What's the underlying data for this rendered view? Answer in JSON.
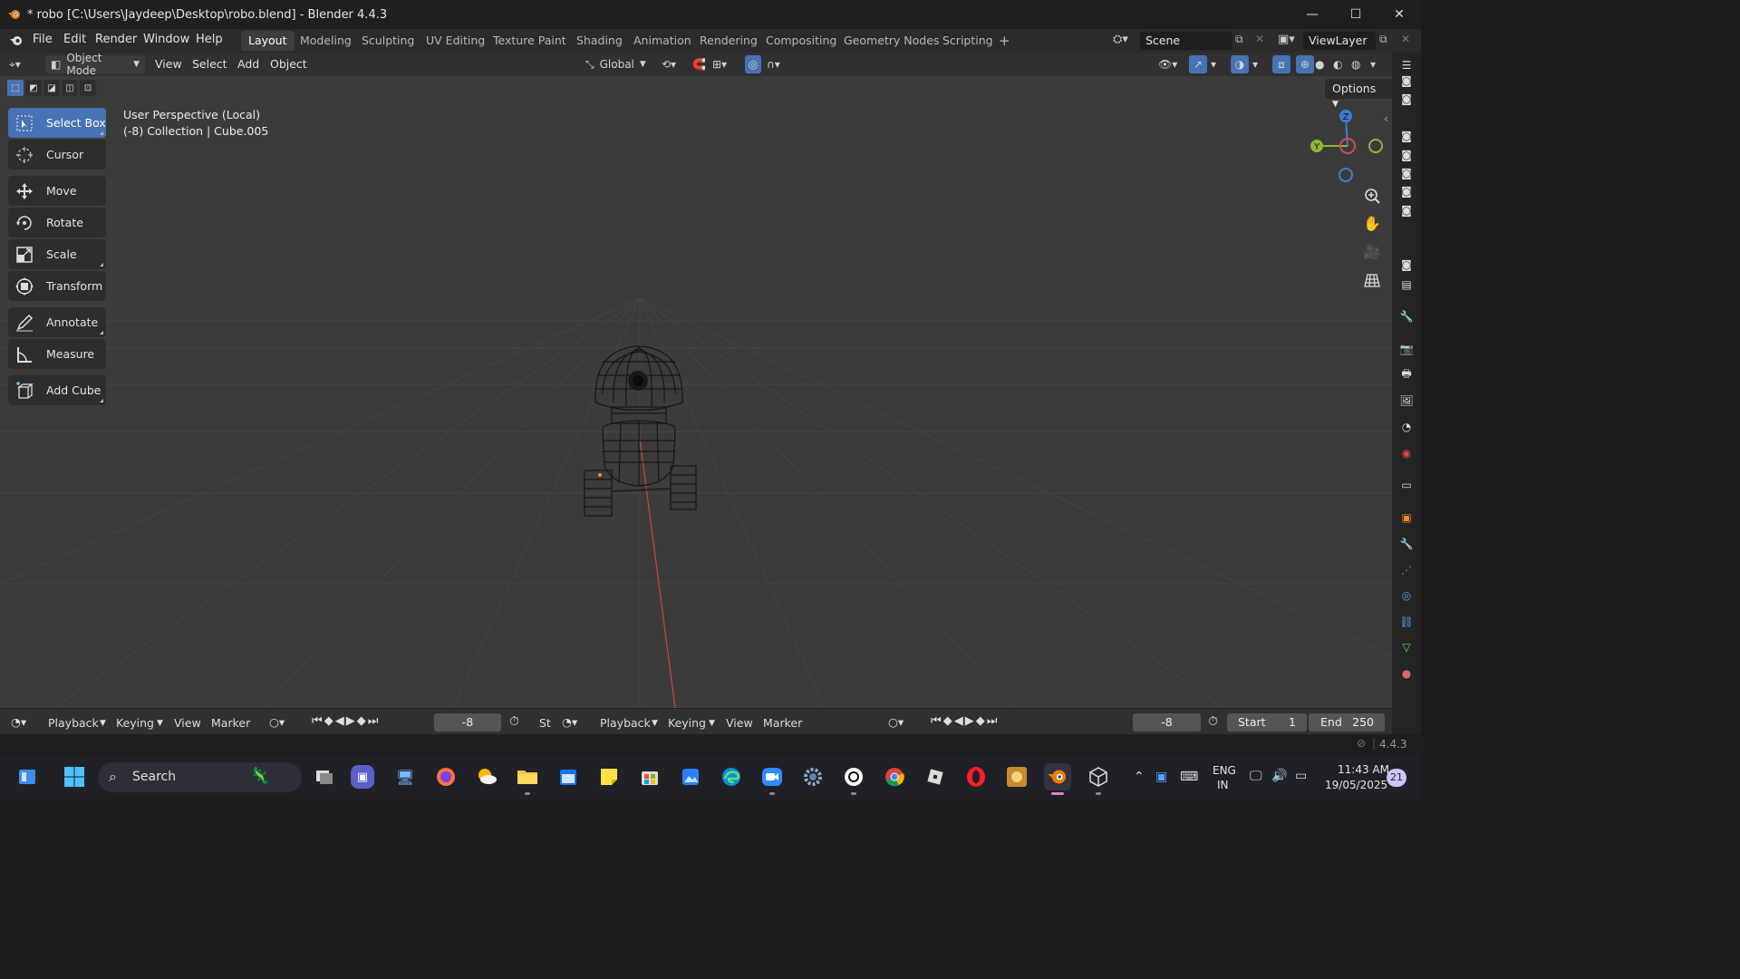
{
  "window": {
    "title": "* robo [C:\\Users\\Jaydeep\\Desktop\\robo.blend] - Blender 4.4.3",
    "minimize": "—",
    "maximize": "☐",
    "close": "✕"
  },
  "menu": [
    "File",
    "Edit",
    "Render",
    "Window",
    "Help"
  ],
  "workspaces": [
    "Layout",
    "Modeling",
    "Sculpting",
    "UV Editing",
    "Texture Paint",
    "Shading",
    "Animation",
    "Rendering",
    "Compositing",
    "Geometry Nodes",
    "Scripting"
  ],
  "active_workspace": "Layout",
  "scene": {
    "name": "Scene",
    "view_layer": "ViewLayer"
  },
  "header": {
    "mode": "Object Mode",
    "menus": [
      "View",
      "Select",
      "Add",
      "Object"
    ],
    "orientation": "Global",
    "options": "Options"
  },
  "tools": [
    {
      "label": "Select Box",
      "icon": "select-box-icon",
      "active": true
    },
    {
      "label": "Cursor",
      "icon": "cursor-icon"
    },
    {
      "label": "Move",
      "icon": "move-icon"
    },
    {
      "label": "Rotate",
      "icon": "rotate-icon"
    },
    {
      "label": "Scale",
      "icon": "scale-icon"
    },
    {
      "label": "Transform",
      "icon": "transform-icon"
    },
    {
      "label": "Annotate",
      "icon": "annotate-icon"
    },
    {
      "label": "Measure",
      "icon": "measure-icon"
    },
    {
      "label": "Add Cube",
      "icon": "add-cube-icon"
    }
  ],
  "viewport": {
    "perspective": "User Perspective (Local)",
    "collection": "(-8) Collection | Cube.005"
  },
  "gizmo": {
    "z": "Z",
    "y": "Y"
  },
  "timeline": {
    "left": {
      "menus": [
        "Playback",
        "Keying",
        "View",
        "Marker"
      ],
      "frame": "-8",
      "start_abbrev": "St"
    },
    "right": {
      "menus": [
        "Playback",
        "Keying",
        "View",
        "Marker"
      ],
      "frame": "-8",
      "start_label": "Start",
      "start": "1",
      "end_label": "End",
      "end": "250"
    }
  },
  "status": {
    "version": "4.4.3"
  },
  "taskbar": {
    "search": "Search",
    "lang": "ENG",
    "region": "IN",
    "time": "11:43 AM",
    "date": "19/05/2025",
    "notifications": "21"
  },
  "colors": {
    "accent": "#4772b3",
    "viewport": "#3b3b3b",
    "axis_x": "#d44a4a",
    "axis_y": "#8bb83a",
    "axis_z": "#3f7bd6"
  }
}
